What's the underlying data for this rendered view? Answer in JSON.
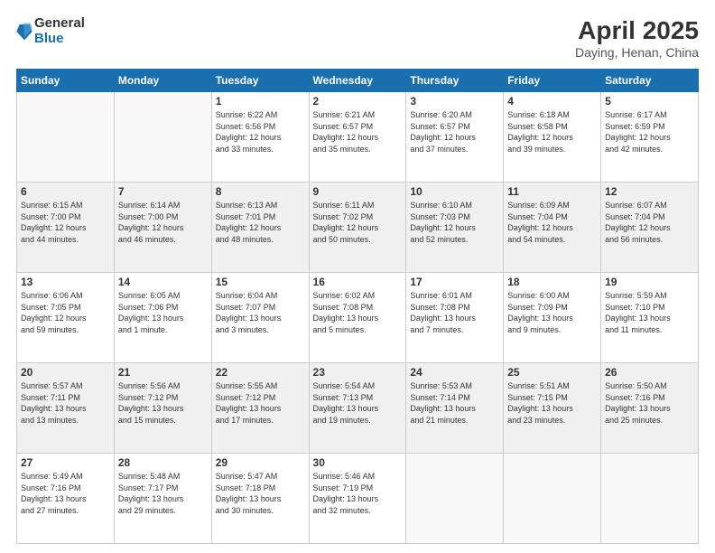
{
  "header": {
    "logo_general": "General",
    "logo_blue": "Blue",
    "month_title": "April 2025",
    "subtitle": "Daying, Henan, China"
  },
  "weekdays": [
    "Sunday",
    "Monday",
    "Tuesday",
    "Wednesday",
    "Thursday",
    "Friday",
    "Saturday"
  ],
  "weeks": [
    [
      {
        "day": "",
        "info": ""
      },
      {
        "day": "",
        "info": ""
      },
      {
        "day": "1",
        "info": "Sunrise: 6:22 AM\nSunset: 6:56 PM\nDaylight: 12 hours\nand 33 minutes."
      },
      {
        "day": "2",
        "info": "Sunrise: 6:21 AM\nSunset: 6:57 PM\nDaylight: 12 hours\nand 35 minutes."
      },
      {
        "day": "3",
        "info": "Sunrise: 6:20 AM\nSunset: 6:57 PM\nDaylight: 12 hours\nand 37 minutes."
      },
      {
        "day": "4",
        "info": "Sunrise: 6:18 AM\nSunset: 6:58 PM\nDaylight: 12 hours\nand 39 minutes."
      },
      {
        "day": "5",
        "info": "Sunrise: 6:17 AM\nSunset: 6:59 PM\nDaylight: 12 hours\nand 42 minutes."
      }
    ],
    [
      {
        "day": "6",
        "info": "Sunrise: 6:15 AM\nSunset: 7:00 PM\nDaylight: 12 hours\nand 44 minutes."
      },
      {
        "day": "7",
        "info": "Sunrise: 6:14 AM\nSunset: 7:00 PM\nDaylight: 12 hours\nand 46 minutes."
      },
      {
        "day": "8",
        "info": "Sunrise: 6:13 AM\nSunset: 7:01 PM\nDaylight: 12 hours\nand 48 minutes."
      },
      {
        "day": "9",
        "info": "Sunrise: 6:11 AM\nSunset: 7:02 PM\nDaylight: 12 hours\nand 50 minutes."
      },
      {
        "day": "10",
        "info": "Sunrise: 6:10 AM\nSunset: 7:03 PM\nDaylight: 12 hours\nand 52 minutes."
      },
      {
        "day": "11",
        "info": "Sunrise: 6:09 AM\nSunset: 7:04 PM\nDaylight: 12 hours\nand 54 minutes."
      },
      {
        "day": "12",
        "info": "Sunrise: 6:07 AM\nSunset: 7:04 PM\nDaylight: 12 hours\nand 56 minutes."
      }
    ],
    [
      {
        "day": "13",
        "info": "Sunrise: 6:06 AM\nSunset: 7:05 PM\nDaylight: 12 hours\nand 59 minutes."
      },
      {
        "day": "14",
        "info": "Sunrise: 6:05 AM\nSunset: 7:06 PM\nDaylight: 13 hours\nand 1 minute."
      },
      {
        "day": "15",
        "info": "Sunrise: 6:04 AM\nSunset: 7:07 PM\nDaylight: 13 hours\nand 3 minutes."
      },
      {
        "day": "16",
        "info": "Sunrise: 6:02 AM\nSunset: 7:08 PM\nDaylight: 13 hours\nand 5 minutes."
      },
      {
        "day": "17",
        "info": "Sunrise: 6:01 AM\nSunset: 7:08 PM\nDaylight: 13 hours\nand 7 minutes."
      },
      {
        "day": "18",
        "info": "Sunrise: 6:00 AM\nSunset: 7:09 PM\nDaylight: 13 hours\nand 9 minutes."
      },
      {
        "day": "19",
        "info": "Sunrise: 5:59 AM\nSunset: 7:10 PM\nDaylight: 13 hours\nand 11 minutes."
      }
    ],
    [
      {
        "day": "20",
        "info": "Sunrise: 5:57 AM\nSunset: 7:11 PM\nDaylight: 13 hours\nand 13 minutes."
      },
      {
        "day": "21",
        "info": "Sunrise: 5:56 AM\nSunset: 7:12 PM\nDaylight: 13 hours\nand 15 minutes."
      },
      {
        "day": "22",
        "info": "Sunrise: 5:55 AM\nSunset: 7:12 PM\nDaylight: 13 hours\nand 17 minutes."
      },
      {
        "day": "23",
        "info": "Sunrise: 5:54 AM\nSunset: 7:13 PM\nDaylight: 13 hours\nand 19 minutes."
      },
      {
        "day": "24",
        "info": "Sunrise: 5:53 AM\nSunset: 7:14 PM\nDaylight: 13 hours\nand 21 minutes."
      },
      {
        "day": "25",
        "info": "Sunrise: 5:51 AM\nSunset: 7:15 PM\nDaylight: 13 hours\nand 23 minutes."
      },
      {
        "day": "26",
        "info": "Sunrise: 5:50 AM\nSunset: 7:16 PM\nDaylight: 13 hours\nand 25 minutes."
      }
    ],
    [
      {
        "day": "27",
        "info": "Sunrise: 5:49 AM\nSunset: 7:16 PM\nDaylight: 13 hours\nand 27 minutes."
      },
      {
        "day": "28",
        "info": "Sunrise: 5:48 AM\nSunset: 7:17 PM\nDaylight: 13 hours\nand 29 minutes."
      },
      {
        "day": "29",
        "info": "Sunrise: 5:47 AM\nSunset: 7:18 PM\nDaylight: 13 hours\nand 30 minutes."
      },
      {
        "day": "30",
        "info": "Sunrise: 5:46 AM\nSunset: 7:19 PM\nDaylight: 13 hours\nand 32 minutes."
      },
      {
        "day": "",
        "info": ""
      },
      {
        "day": "",
        "info": ""
      },
      {
        "day": "",
        "info": ""
      }
    ]
  ]
}
